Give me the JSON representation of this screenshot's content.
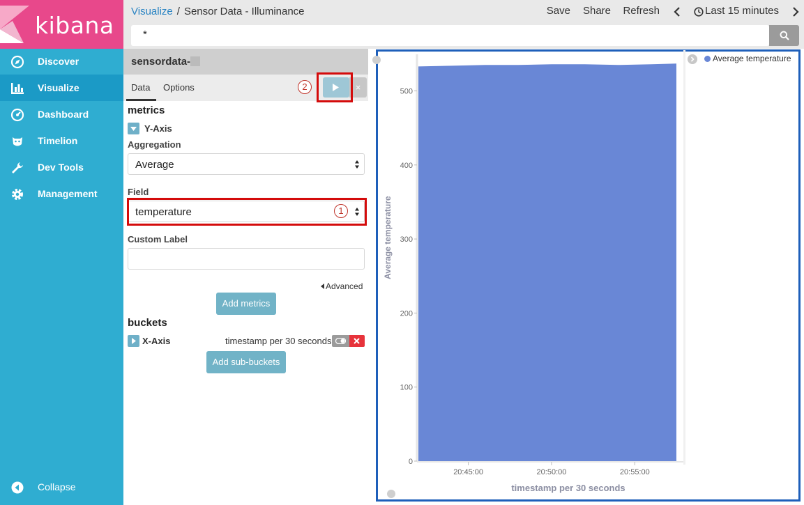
{
  "app": {
    "name": "kibana"
  },
  "sidebar": {
    "items": [
      {
        "label": "Discover",
        "icon": "compass-icon"
      },
      {
        "label": "Visualize",
        "icon": "bar-chart-icon"
      },
      {
        "label": "Dashboard",
        "icon": "dashboard-icon"
      },
      {
        "label": "Timelion",
        "icon": "lion-icon"
      },
      {
        "label": "Dev Tools",
        "icon": "wrench-icon"
      },
      {
        "label": "Management",
        "icon": "gear-icon"
      }
    ],
    "collapse_label": "Collapse"
  },
  "header": {
    "breadcrumb_root": "Visualize",
    "breadcrumb_separator": "/",
    "title": "Sensor Data - Illuminance",
    "save_label": "Save",
    "share_label": "Share",
    "refresh_label": "Refresh",
    "time_range_label": "Last 15 minutes"
  },
  "search": {
    "value": "*"
  },
  "editor": {
    "index_pattern": "sensordata-",
    "tabs": [
      {
        "label": "Data"
      },
      {
        "label": "Options"
      }
    ],
    "active_tab": "Data",
    "metrics_title": "metrics",
    "y_axis_label": "Y-Axis",
    "aggregation_label": "Aggregation",
    "aggregation_value": "Average",
    "field_label": "Field",
    "field_value": "temperature",
    "custom_label_label": "Custom Label",
    "custom_label_value": "",
    "advanced_label": "Advanced",
    "add_metrics_label": "Add metrics",
    "buckets_title": "buckets",
    "x_axis_label": "X-Axis",
    "x_axis_summary": "timestamp per 30 seconds",
    "add_sub_buckets_label": "Add sub-buckets",
    "discard_label": "×"
  },
  "annotations": {
    "one": "1",
    "two": "2",
    "color": "#d40b0b"
  },
  "colors": {
    "brand": "#e8488b",
    "sidebar": "#2fadd1",
    "sidebar_active": "#1b9ac6",
    "series": "#6987d6",
    "frame": "#1e5fba"
  },
  "chart_data": {
    "type": "area",
    "title": "",
    "xlabel": "timestamp per 30 seconds",
    "ylabel": "Average temperature",
    "x_tick_labels": [
      "20:45:00",
      "20:50:00",
      "20:55:00"
    ],
    "y_ticks": [
      0,
      100,
      200,
      300,
      400,
      500
    ],
    "ylim": [
      0,
      540
    ],
    "series": [
      {
        "name": "Average temperature",
        "color": "#6987d6",
        "x": [
          "20:42:00",
          "20:44:00",
          "20:46:00",
          "20:48:00",
          "20:50:00",
          "20:52:00",
          "20:54:00",
          "20:56:00",
          "20:57:30"
        ],
        "values": [
          533,
          534,
          535,
          535,
          536,
          536,
          535,
          536,
          537
        ]
      }
    ],
    "legend_position": "top-right",
    "grid": false
  }
}
